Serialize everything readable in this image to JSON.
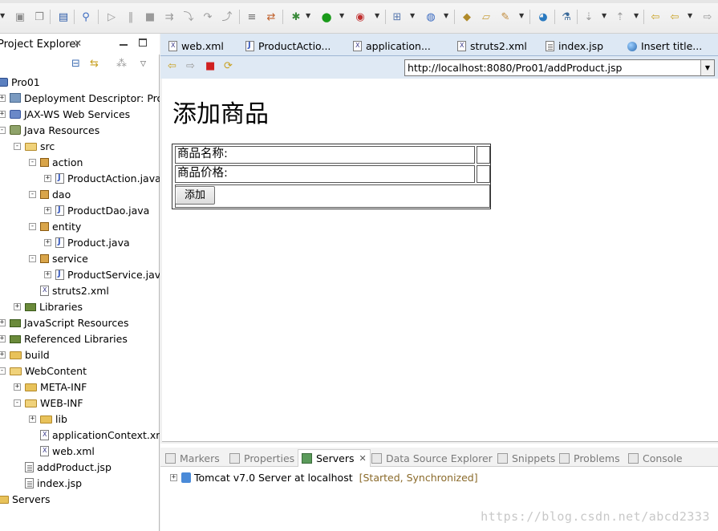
{
  "explorer": {
    "title": "Project Explorer",
    "tree": [
      {
        "label": "Pro01",
        "level": 0,
        "icon": "project-icon",
        "twisty": "none"
      },
      {
        "label": "Deployment Descriptor: Pro",
        "level": 1,
        "icon": "deployment-descriptor-icon",
        "twisty": "+"
      },
      {
        "label": "JAX-WS Web Services",
        "level": 1,
        "icon": "web-services-icon",
        "twisty": "+"
      },
      {
        "label": "Java Resources",
        "level": 1,
        "icon": "java-resources-icon",
        "twisty": "-"
      },
      {
        "label": "src",
        "level": 2,
        "icon": "source-folder-icon",
        "twisty": "-"
      },
      {
        "label": "action",
        "level": 3,
        "icon": "package-icon",
        "twisty": "-"
      },
      {
        "label": "ProductAction.java",
        "level": 4,
        "icon": "java-file-icon",
        "twisty": "+"
      },
      {
        "label": "dao",
        "level": 3,
        "icon": "package-icon",
        "twisty": "-"
      },
      {
        "label": "ProductDao.java",
        "level": 4,
        "icon": "java-file-icon",
        "twisty": "+"
      },
      {
        "label": "entity",
        "level": 3,
        "icon": "package-icon",
        "twisty": "-"
      },
      {
        "label": "Product.java",
        "level": 4,
        "icon": "java-file-icon",
        "twisty": "+"
      },
      {
        "label": "service",
        "level": 3,
        "icon": "package-icon",
        "twisty": "-"
      },
      {
        "label": "ProductService.java",
        "level": 4,
        "icon": "java-file-icon",
        "twisty": "+"
      },
      {
        "label": "struts2.xml",
        "level": 3,
        "icon": "xml-file-icon",
        "twisty": "none"
      },
      {
        "label": "Libraries",
        "level": 2,
        "icon": "libraries-icon",
        "twisty": "+"
      },
      {
        "label": "JavaScript Resources",
        "level": 1,
        "icon": "libraries-icon",
        "twisty": "+"
      },
      {
        "label": "Referenced Libraries",
        "level": 1,
        "icon": "libraries-icon",
        "twisty": "+"
      },
      {
        "label": "build",
        "level": 1,
        "icon": "folder-icon",
        "twisty": "+"
      },
      {
        "label": "WebContent",
        "level": 1,
        "icon": "folder-open-icon",
        "twisty": "-"
      },
      {
        "label": "META-INF",
        "level": 2,
        "icon": "folder-icon",
        "twisty": "+"
      },
      {
        "label": "WEB-INF",
        "level": 2,
        "icon": "folder-open-icon",
        "twisty": "-"
      },
      {
        "label": "lib",
        "level": 3,
        "icon": "folder-icon",
        "twisty": "+"
      },
      {
        "label": "applicationContext.xml",
        "level": 3,
        "icon": "xml-file-icon",
        "twisty": "none"
      },
      {
        "label": "web.xml",
        "level": 3,
        "icon": "xml-file-icon",
        "twisty": "none"
      },
      {
        "label": "addProduct.jsp",
        "level": 2,
        "icon": "jsp-file-icon",
        "twisty": "none"
      },
      {
        "label": "index.jsp",
        "level": 2,
        "icon": "jsp-file-icon",
        "twisty": "none"
      },
      {
        "label": "Servers",
        "level": 0,
        "icon": "folder-icon",
        "twisty": "none"
      }
    ]
  },
  "editor_tabs": [
    {
      "label": "web.xml",
      "icon": "xml-file-icon"
    },
    {
      "label": "ProductActio...",
      "icon": "java-file-icon"
    },
    {
      "label": "application...",
      "icon": "xml-file-icon"
    },
    {
      "label": "struts2.xml",
      "icon": "xml-file-icon"
    },
    {
      "label": "index.jsp",
      "icon": "jsp-file-icon"
    },
    {
      "label": "Insert title...",
      "icon": "globe-icon"
    }
  ],
  "browser": {
    "url": "http://localhost:8080/Pro01/addProduct.jsp",
    "page_title": "添加商品",
    "form": {
      "name_label": "商品名称:",
      "price_label": "商品价格:",
      "submit_label": "添加"
    }
  },
  "views": {
    "tabs": [
      "Markers",
      "Properties",
      "Servers",
      "Data Source Explorer",
      "Snippets",
      "Problems",
      "Console"
    ],
    "server_name": "Tomcat v7.0 Server at localhost",
    "server_status": "[Started, Synchronized]"
  },
  "watermark": "https://blog.csdn.net/abcd2333"
}
